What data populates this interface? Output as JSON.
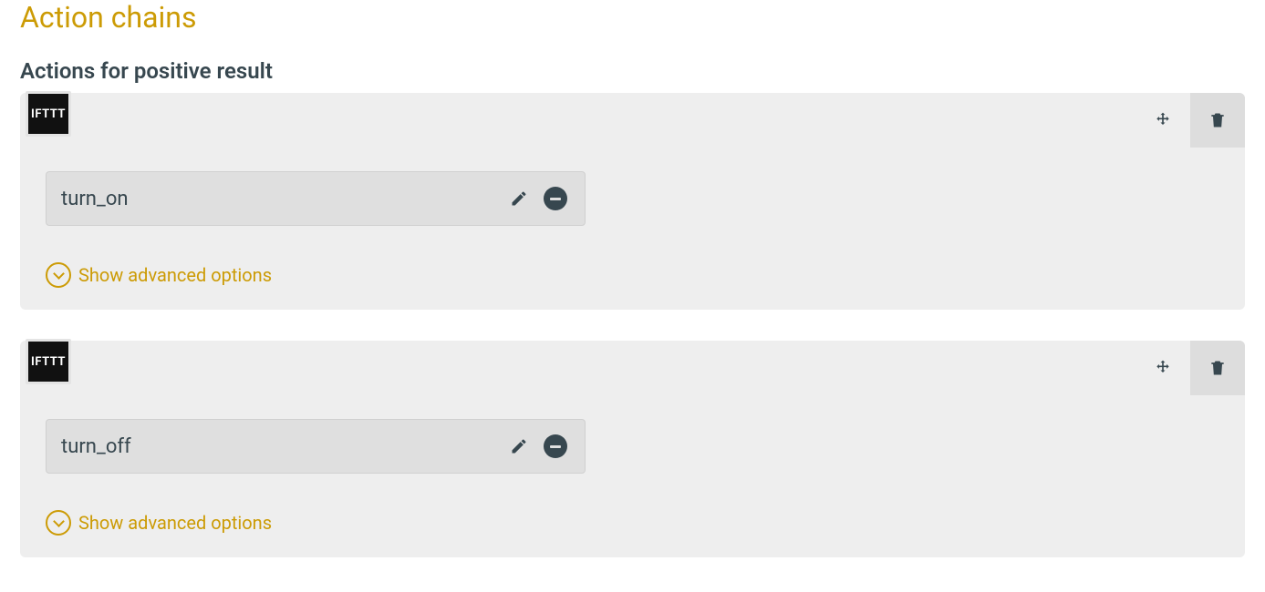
{
  "page": {
    "title": "Action chains",
    "positive_section_title": "Actions for positive result"
  },
  "service_label": "IFTTT",
  "actions": [
    {
      "name": "turn_on",
      "advanced_label": "Show advanced options"
    },
    {
      "name": "turn_off",
      "advanced_label": "Show advanced options"
    }
  ]
}
